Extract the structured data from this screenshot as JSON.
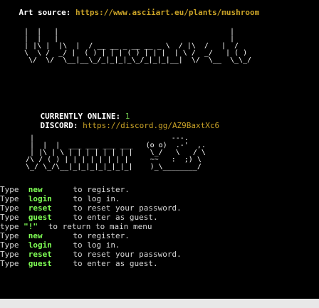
{
  "header": {
    "source_label": "Art source:",
    "source_url": "https://www.asciiart.eu/plants/mushroom"
  },
  "art_top": " |  |   |                                        |     \n |  |   |                                        |     \n | |\\ |  |\\  |  / __ __ _ __ __ _ \\  / |\\  /   |  /  \n \\  \\ /  _/ |  ( ) | | | ( ) | | |  | \\ /  _/   | ( ) \n  \\/  \\/  \\__|__\\_/_|_|_|_\\_/_|_|_|__|  \\/  \\__  \\_\\_/",
  "status": {
    "online_label": "CURRENTLY ONLINE:",
    "online_count": "1",
    "discord_label": "DISCORD:",
    "discord_url": "https://discord.gg/AZ9BaxtXc6"
  },
  "art_mid": "  |                                ---.       \n  |  |  |  ___ ___ ___ ___   (o o)  .-'  ,. \n  | |\\ | \\ | | | | | | | |    \\_/   \\   / \\  \n /\\ / ( ) | | | | | | | |     ~~   :  ;) \\ \n \\_/ \\_/\\__|_|_|_|_|_|_|_|    )_\\________/  ",
  "commands": [
    {
      "prefix": "Type",
      "keyword": "new",
      "text": "to register."
    },
    {
      "prefix": "Type",
      "keyword": "login",
      "text": "to log in."
    },
    {
      "prefix": "Type",
      "keyword": "reset",
      "text": "to reset your password."
    },
    {
      "prefix": "Type",
      "keyword": "guest",
      "text": "to enter as guest."
    },
    {
      "prefix": "type",
      "keyword": "\"!\"",
      "text": "to return to main menu"
    },
    {
      "prefix": "Type",
      "keyword": "new",
      "text": "to register."
    },
    {
      "prefix": "Type",
      "keyword": "login",
      "text": "to log in."
    },
    {
      "prefix": "Type",
      "keyword": "reset",
      "text": "to reset your password."
    },
    {
      "prefix": "Type",
      "keyword": "guest",
      "text": "to enter as guest."
    }
  ],
  "colors": {
    "background": "#000000",
    "url": "#c9a227",
    "keyword": "#7fff55",
    "online_count": "#6cc04a",
    "text": "#d7d7d7"
  }
}
